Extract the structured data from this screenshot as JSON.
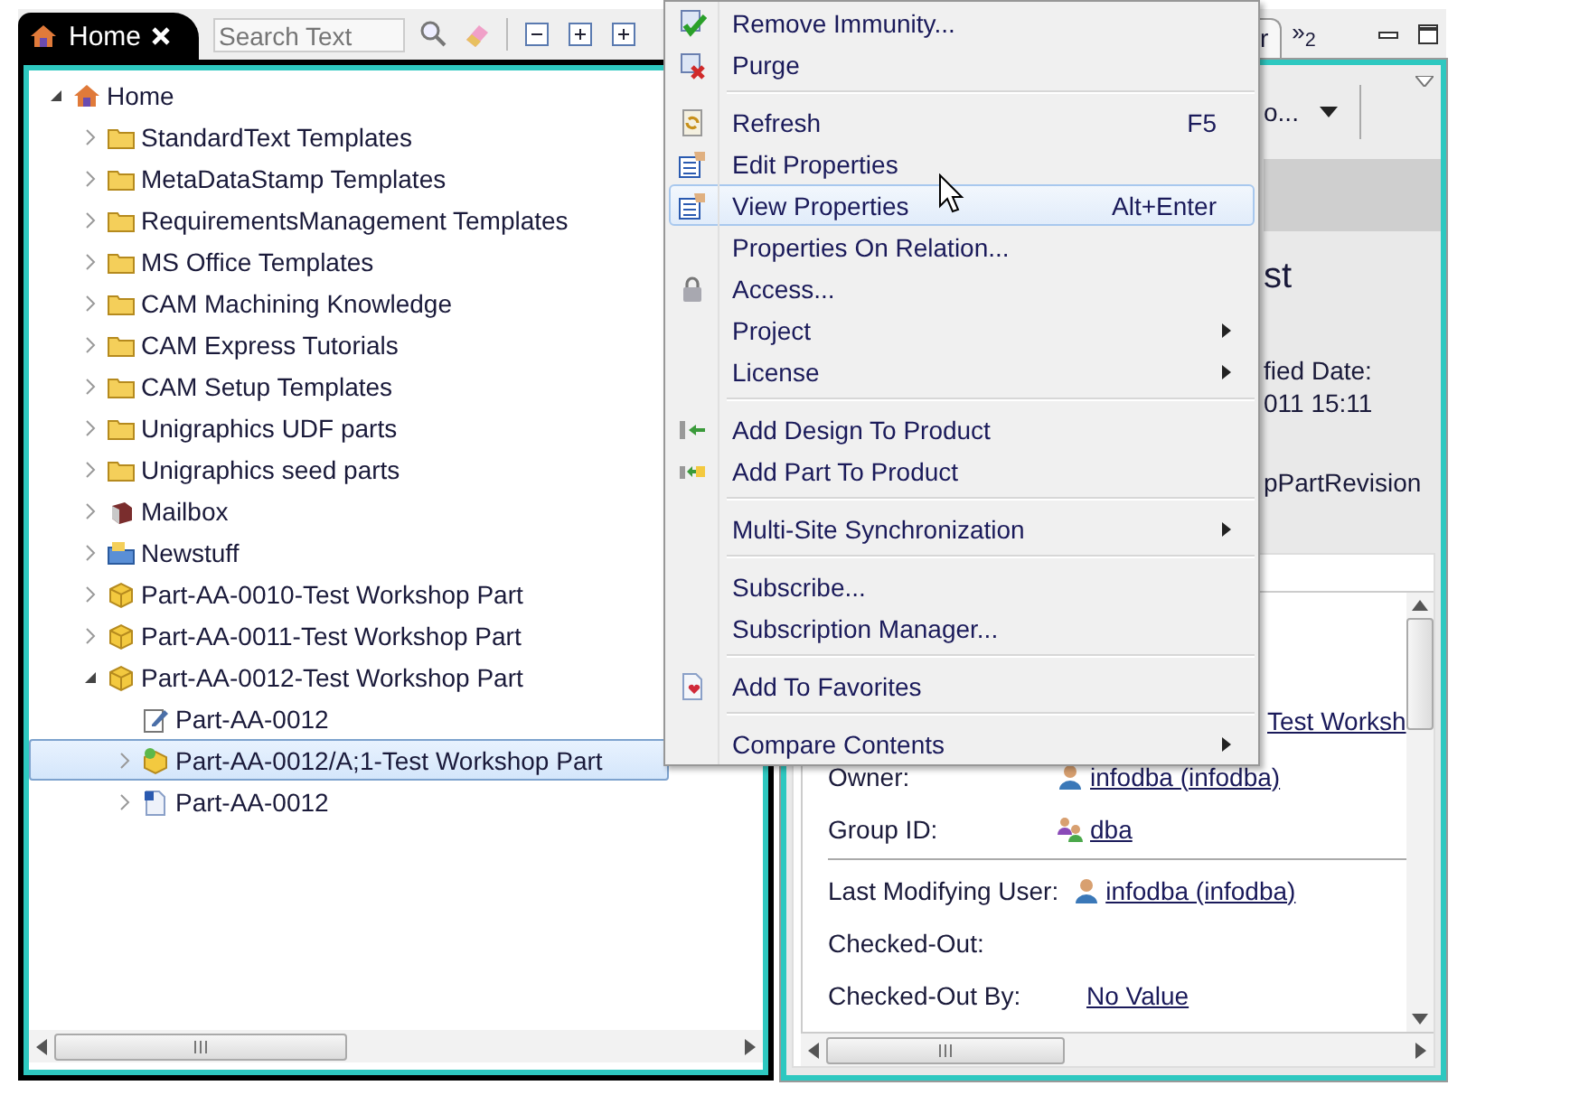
{
  "left_panel": {
    "tab": {
      "label": "Home",
      "selected": true
    },
    "search": {
      "placeholder": "Search Text"
    },
    "tree": [
      {
        "label": "Home",
        "kind": "home",
        "expanded": true,
        "selected": false,
        "children": [
          {
            "label": "StandardText Templates",
            "kind": "folder",
            "expanded": false,
            "selected": false
          },
          {
            "label": "MetaDataStamp Templates",
            "kind": "folder",
            "expanded": false,
            "selected": false
          },
          {
            "label": "RequirementsManagement Templates",
            "kind": "folder",
            "expanded": false,
            "selected": false
          },
          {
            "label": "MS Office Templates",
            "kind": "folder",
            "expanded": false,
            "selected": false
          },
          {
            "label": "CAM Machining Knowledge",
            "kind": "folder",
            "expanded": false,
            "selected": false
          },
          {
            "label": "CAM Express Tutorials",
            "kind": "folder",
            "expanded": false,
            "selected": false
          },
          {
            "label": "CAM Setup Templates",
            "kind": "folder",
            "expanded": false,
            "selected": false
          },
          {
            "label": "Unigraphics UDF parts",
            "kind": "folder",
            "expanded": false,
            "selected": false
          },
          {
            "label": "Unigraphics seed parts",
            "kind": "folder",
            "expanded": false,
            "selected": false
          },
          {
            "label": "Mailbox",
            "kind": "mailbox",
            "expanded": false,
            "selected": false
          },
          {
            "label": "Newstuff",
            "kind": "newstuff",
            "expanded": false,
            "selected": false
          },
          {
            "label": "Part-AA-0010-Test Workshop Part",
            "kind": "part",
            "expanded": false,
            "selected": false
          },
          {
            "label": "Part-AA-0011-Test Workshop Part",
            "kind": "part",
            "expanded": false,
            "selected": false
          },
          {
            "label": "Part-AA-0012-Test Workshop Part",
            "kind": "part",
            "expanded": true,
            "selected": false,
            "children": [
              {
                "label": "Part-AA-0012",
                "kind": "dataset",
                "selected": false
              },
              {
                "label": "Part-AA-0012/A;1-Test Workshop Part",
                "kind": "revision",
                "expanded": false,
                "selected": true
              },
              {
                "label": "Part-AA-0012",
                "kind": "document",
                "expanded": false,
                "selected": false
              }
            ]
          }
        ]
      }
    ]
  },
  "right_panel": {
    "tab": {
      "label": "r"
    },
    "overflow": "»$_{2}$",
    "toolbar_label": "o...",
    "title": "st",
    "date_label": "fied Date:",
    "date_value": "011 15:11",
    "type_text": "pPartRevision",
    "details": {
      "link": "Test Worksh",
      "groups": [
        [
          {
            "label": "Owner:",
            "kind": "user",
            "value": "infodba (infodba)"
          },
          {
            "label": "Group ID:",
            "kind": "group",
            "value": "dba"
          }
        ],
        [
          {
            "label": "Last Modifying User:",
            "kind": "user",
            "value": "infodba (infodba)"
          },
          {
            "label": "Checked-Out:",
            "kind": "text"
          },
          {
            "label": "Checked-Out By:",
            "kind": "text",
            "value": "No Value"
          }
        ]
      ]
    }
  },
  "context_menu": {
    "groups": [
      [
        {
          "label": "Remove Immunity...",
          "kind": "check",
          "selected": false
        },
        {
          "label": "Purge",
          "kind": "purge",
          "selected": false
        }
      ],
      [
        {
          "label": "Refresh",
          "kind": "refresh",
          "shortcut": "F5",
          "selected": false
        },
        {
          "label": "Edit Properties",
          "kind": "properties",
          "selected": false
        },
        {
          "label": "View Properties",
          "kind": "properties",
          "shortcut": "Alt+Enter",
          "selected": true
        },
        {
          "label": "Properties On Relation...",
          "kind": "plain",
          "selected": false
        },
        {
          "label": "Access...",
          "kind": "lock",
          "selected": false
        },
        {
          "label": "Project",
          "kind": "plain",
          "submenu": true,
          "selected": false
        },
        {
          "label": "License",
          "kind": "plain",
          "submenu": true,
          "selected": false
        }
      ],
      [
        {
          "label": "Add Design To Product",
          "kind": "add-design",
          "selected": false
        },
        {
          "label": "Add Part To Product",
          "kind": "add-part",
          "selected": false
        }
      ],
      [
        {
          "label": "Multi-Site Synchronization",
          "kind": "plain",
          "submenu": true,
          "selected": false
        }
      ],
      [
        {
          "label": "Subscribe...",
          "kind": "plain",
          "selected": false
        },
        {
          "label": "Subscription Manager...",
          "kind": "plain",
          "selected": false
        }
      ],
      [
        {
          "label": "Add To Favorites",
          "kind": "favorite",
          "selected": false
        }
      ],
      [
        {
          "label": "Compare Contents",
          "kind": "plain",
          "submenu": true,
          "selected": false
        }
      ]
    ]
  }
}
